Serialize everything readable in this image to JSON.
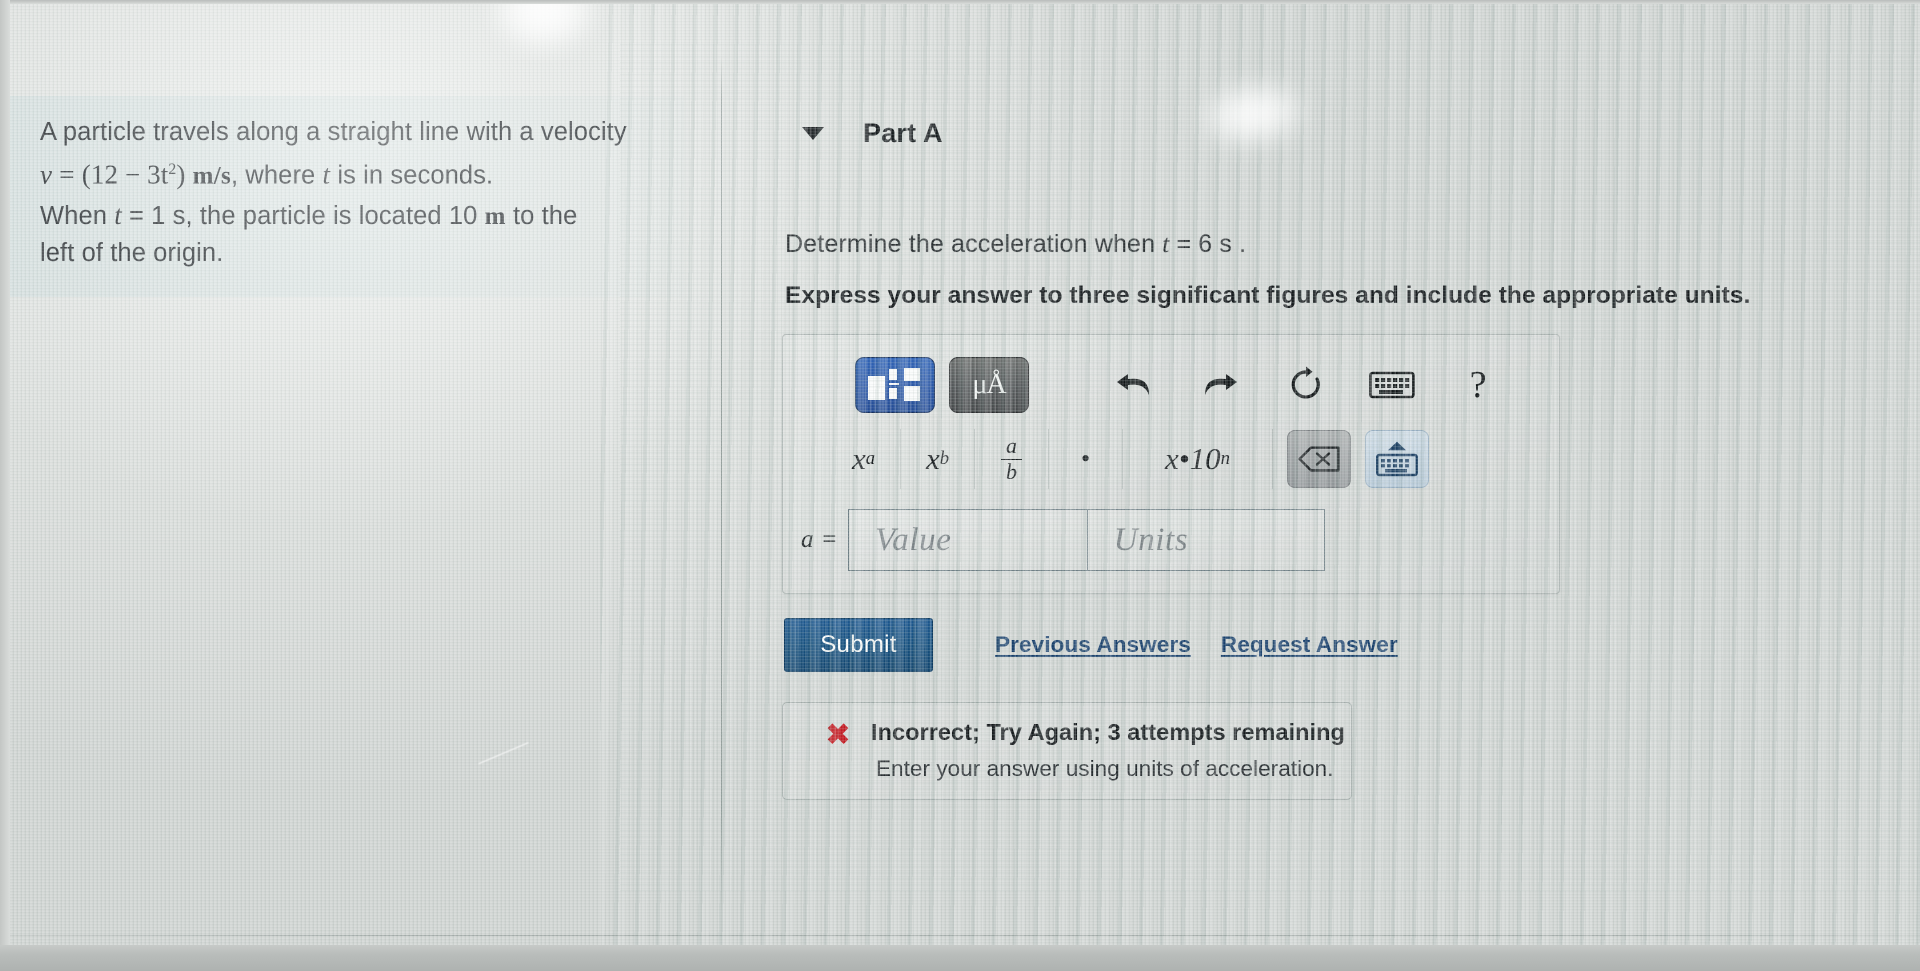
{
  "problem": {
    "line1": "A particle travels along a straight line with a velocity",
    "eq_v": "v",
    "eq_eq": "=",
    "eq_expr_open": "(12 − 3t",
    "eq_expr_exp": "2",
    "eq_expr_close": ")",
    "eq_units": "m/s",
    "line2_tail_a": ", where ",
    "eq_t": "t",
    "line2_tail_b": " is in seconds.",
    "line3_a": "When ",
    "line3_t": "t",
    "line3_b": " = 1 s, the particle is located 10 ",
    "line3_m": "m",
    "line3_c": " to the",
    "line4": "left of the origin."
  },
  "part": {
    "disclosure_icon": "triangle-down-icon",
    "title": "Part A",
    "question_prefix": "Determine the acceleration when ",
    "question_var": "t",
    "question_value": " = 6  s .",
    "instruction": "Express your answer to three significant figures and include the appropriate units."
  },
  "toolbar": {
    "row1": [
      {
        "name": "math-template-palette",
        "label": "",
        "icon": "math-template-icon",
        "state": "active"
      },
      {
        "name": "units-palette",
        "label": "μÅ",
        "icon": "units-icon",
        "state": "active"
      },
      {
        "name": "undo",
        "label": "",
        "icon": "undo-icon",
        "state": "normal"
      },
      {
        "name": "redo",
        "label": "",
        "icon": "redo-icon",
        "state": "normal"
      },
      {
        "name": "reset",
        "label": "",
        "icon": "reset-icon",
        "state": "normal"
      },
      {
        "name": "keyboard-shortcuts",
        "label": "",
        "icon": "keyboard-icon",
        "state": "normal"
      },
      {
        "name": "help",
        "label": "?",
        "icon": "question-mark-icon",
        "state": "normal"
      }
    ],
    "row2": [
      {
        "name": "superscript",
        "base": "x",
        "sup": "a"
      },
      {
        "name": "subscript",
        "base": "x",
        "sub": "b"
      },
      {
        "name": "fraction",
        "num": "a",
        "den": "b"
      },
      {
        "name": "multiplication-dot",
        "glyph": "•"
      },
      {
        "name": "scientific-notation",
        "base": "x•10",
        "sup": "n",
        "display": "x•10"
      }
    ],
    "scinot_label": "x•10",
    "scinot_exp": "n",
    "backspace_icon": "backspace-icon",
    "keyboard_toggle_icon": "keyboard-up-icon"
  },
  "answer": {
    "label": "a =",
    "value": "",
    "value_placeholder": "Value",
    "units": "",
    "units_placeholder": "Units"
  },
  "actions": {
    "submit_label": "Submit",
    "previous_answers_label": "Previous Answers",
    "request_answer_label": "Request Answer"
  },
  "feedback": {
    "status_icon": "red-x-icon",
    "headline": "Incorrect; Try Again; 3 attempts remaining",
    "detail": "Enter your answer using units of acceleration.",
    "accent_color": "#c4141c"
  },
  "colors": {
    "submit_blue": "#155080",
    "link_blue": "#153d6b",
    "palette_blue": "#2a57a8",
    "error_red": "#c4141c",
    "page_bg": "#dcdfdd"
  }
}
